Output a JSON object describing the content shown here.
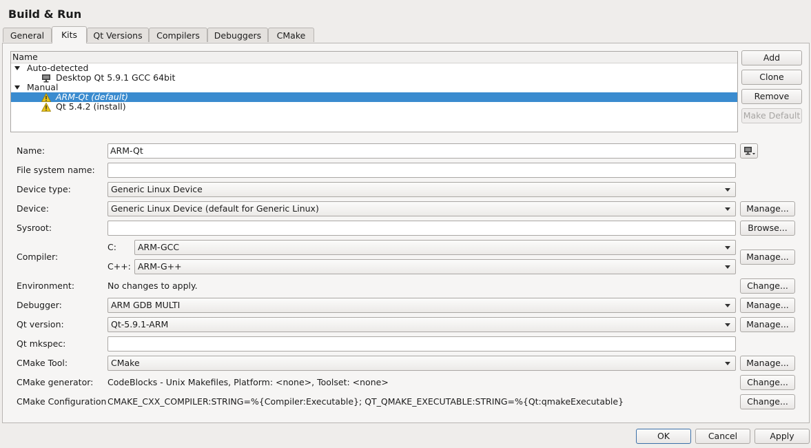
{
  "window": {
    "title": "Build & Run"
  },
  "tabs": [
    "General",
    "Kits",
    "Qt Versions",
    "Compilers",
    "Debuggers",
    "CMake"
  ],
  "active_tab": "Kits",
  "kits_tree": {
    "header": "Name",
    "auto_group": "Auto-detected",
    "auto_kit": "Desktop Qt 5.9.1 GCC 64bit",
    "manual_group": "Manual",
    "manual_kit_selected": "ARM-Qt (default)",
    "manual_kit_other": "Qt 5.4.2 (install)"
  },
  "kit_buttons": {
    "add": "Add",
    "clone": "Clone",
    "remove": "Remove",
    "make_default": "Make Default"
  },
  "form": {
    "name_label": "Name:",
    "name_value": "ARM-Qt",
    "fsname_label": "File system name:",
    "fsname_value": "",
    "device_type_label": "Device type:",
    "device_type_value": "Generic Linux Device",
    "device_label": "Device:",
    "device_value": "Generic Linux Device (default for Generic Linux)",
    "device_btn": "Manage...",
    "sysroot_label": "Sysroot:",
    "sysroot_value": "",
    "sysroot_btn": "Browse...",
    "compiler_label": "Compiler:",
    "compiler_c_label": "C:",
    "compiler_c_value": "ARM-GCC",
    "compiler_cpp_label": "C++:",
    "compiler_cpp_value": "ARM-G++",
    "compiler_btn": "Manage...",
    "environment_label": "Environment:",
    "environment_value": "No changes to apply.",
    "environment_btn": "Change...",
    "debugger_label": "Debugger:",
    "debugger_value": "ARM GDB MULTI",
    "debugger_btn": "Manage...",
    "qtversion_label": "Qt version:",
    "qtversion_value": "Qt-5.9.1-ARM",
    "qtversion_btn": "Manage...",
    "mkspec_label": "Qt mkspec:",
    "mkspec_value": "",
    "cmake_tool_label": "CMake Tool:",
    "cmake_tool_value": "CMake",
    "cmake_tool_btn": "Manage...",
    "cmake_gen_label": "CMake generator:",
    "cmake_gen_value": "CodeBlocks - Unix Makefiles, Platform: <none>, Toolset: <none>",
    "cmake_gen_btn": "Change...",
    "cmake_conf_label": "CMake Configuration",
    "cmake_conf_value": "CMAKE_CXX_COMPILER:STRING=%{Compiler:Executable}; QT_QMAKE_EXECUTABLE:STRING=%{Qt:qmakeExecutable}",
    "cmake_conf_btn": "Change..."
  },
  "dialog_buttons": {
    "ok": "OK",
    "cancel": "Cancel",
    "apply": "Apply"
  },
  "icons": {
    "desktop": "monitor-icon",
    "warning": "warning-icon",
    "device_selector": "monitor-dropdown-icon"
  },
  "colors": {
    "selection": "#3a8bcf",
    "warning": "#e8c41a"
  }
}
